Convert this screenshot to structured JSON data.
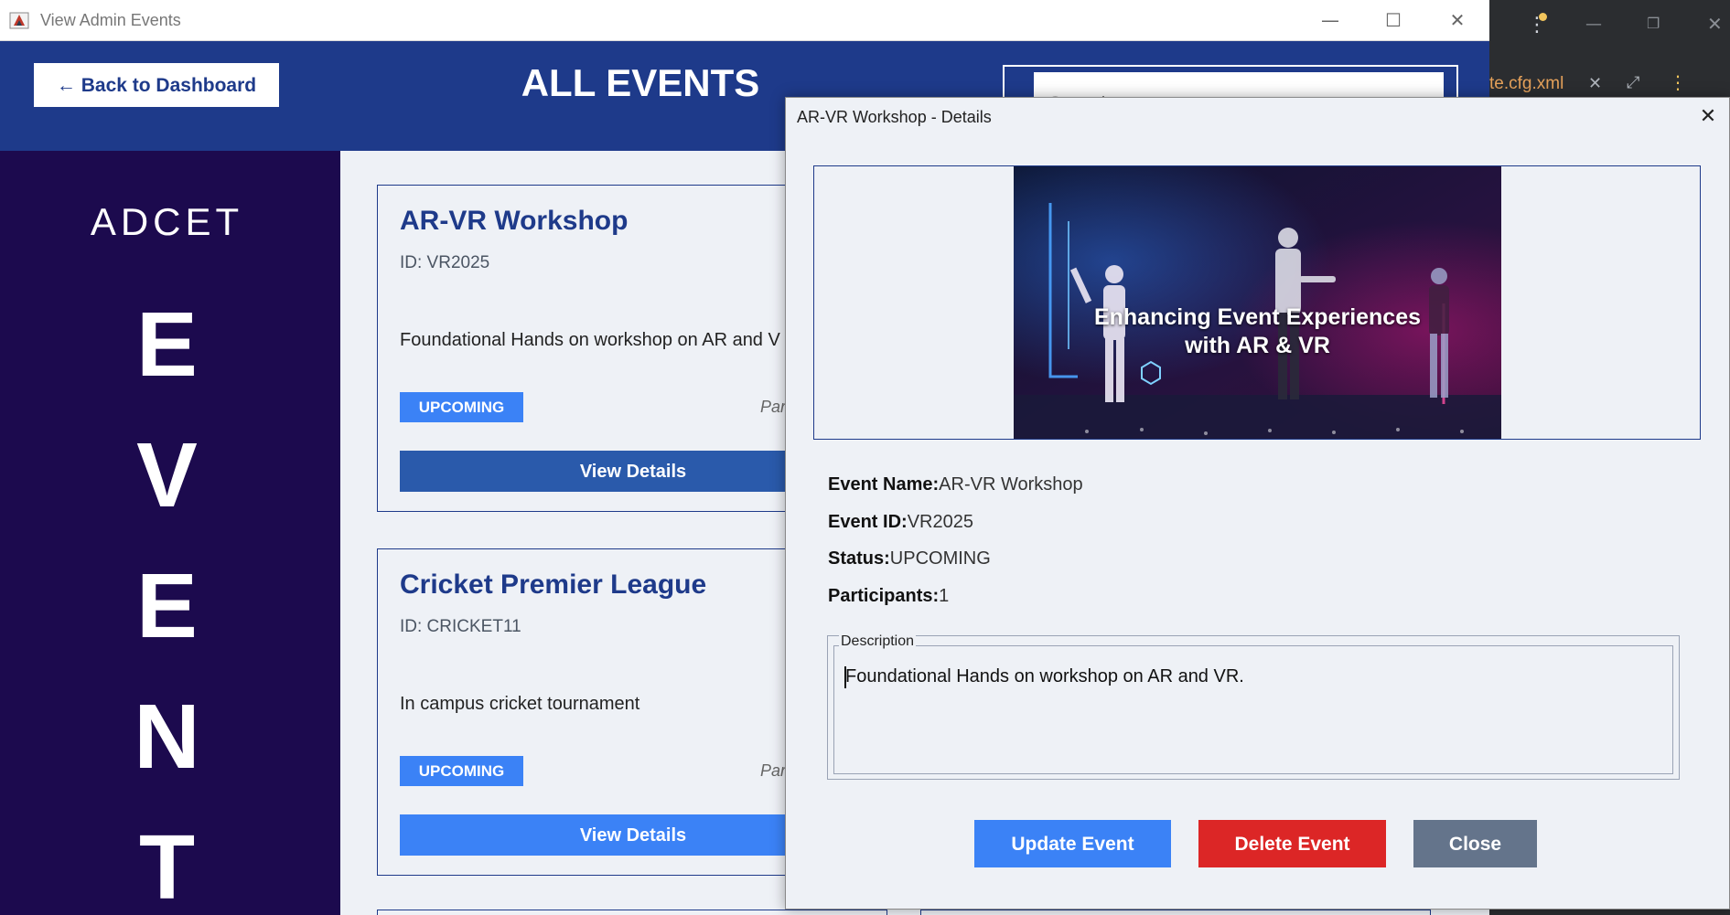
{
  "window": {
    "title": "View Admin Events"
  },
  "ide": {
    "tab_label": "te.cfg.xml"
  },
  "header": {
    "back_label": "← Back to Dashboard",
    "page_title": "ALL EVENTS",
    "search_placeholder": "Search events"
  },
  "sidebar": {
    "brand": "ADCET",
    "letters": [
      "E",
      "V",
      "E",
      "N",
      "T"
    ]
  },
  "events": [
    {
      "title": "AR-VR Workshop",
      "id_text": "ID: VR2025",
      "description": "Foundational Hands on workshop on AR and V",
      "status": "UPCOMING",
      "participants_text": "Par",
      "button_label": "View Details"
    },
    {
      "title": "Cricket Premier League",
      "id_text": "ID: CRICKET11",
      "description": "In campus cricket tournament",
      "status": "UPCOMING",
      "participants_text": "Par",
      "button_label": "View Details"
    }
  ],
  "dialog": {
    "title": "AR-VR Workshop - Details",
    "image_caption_line1": "Enhancing Event Experiences",
    "image_caption_line2": "with AR & VR",
    "name_label": "Event Name:",
    "name_value": "AR-VR Workshop",
    "id_label": "Event ID:",
    "id_value": "VR2025",
    "status_label": "Status:",
    "status_value": "UPCOMING",
    "participants_label": "Participants:",
    "participants_value": "1",
    "description_legend": "Description",
    "description_text": "Foundational Hands on workshop on AR and VR.",
    "update_label": "Update Event",
    "delete_label": "Delete Event",
    "close_label": "Close"
  },
  "colors": {
    "header_bg": "#1e3a8a",
    "sidebar_bg": "#1c0a4e",
    "accent_blue": "#3b82f6",
    "view_btn_dark": "#2a5aab",
    "delete_red": "#dc2626",
    "close_gray": "#64748b"
  },
  "icons": {
    "app": "java-app-icon",
    "minimize": "minimize-icon",
    "maximize": "maximize-icon",
    "close": "close-icon"
  }
}
